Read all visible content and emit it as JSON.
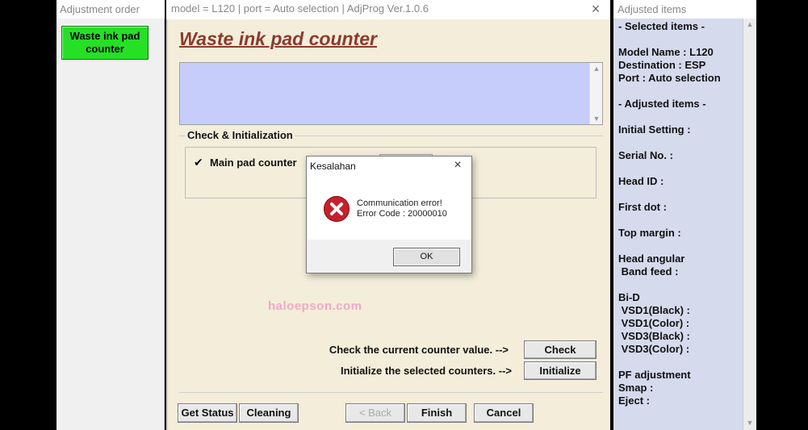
{
  "left_pane": {
    "title": "Adjustment order",
    "items": [
      {
        "label_line1": "Waste ink pad",
        "label_line2": "counter",
        "selected": true,
        "color": "#25e025"
      }
    ]
  },
  "main_window": {
    "titlebar": "model = L120 | port = Auto selection | AdjProg Ver.1.0.6",
    "close_icon": "×",
    "page_title": "Waste ink pad counter",
    "group_label": "Check & Initialization",
    "main_pad_counter": {
      "label": "Main pad counter",
      "checked": true,
      "check_glyph": "✔"
    },
    "watermark": "haloepson.com",
    "check_label": "Check the current counter value. -->",
    "check_button": "Check",
    "init_label": "Initialize the selected counters. -->",
    "init_button": "Initialize",
    "bottom_buttons": {
      "get_status": "Get Status",
      "cleaning": "Cleaning",
      "back": "< Back",
      "finish": "Finish",
      "cancel": "Cancel"
    },
    "accent_colors": {
      "title": "#8b3a2e",
      "info_box": "#c6cdfb",
      "background": "#f3edda"
    }
  },
  "error_dialog": {
    "title": "Kesalahan",
    "close_icon": "×",
    "icon": "error-x-icon",
    "message_line1": "Communication error!",
    "message_line2": "Error Code : 20000010",
    "ok_button": "OK"
  },
  "right_pane": {
    "title": "Adjusted items",
    "lines": [
      {
        "text": "- Selected items -"
      },
      {
        "text": "Model Name : L120"
      },
      {
        "text": "Destination : ESP"
      },
      {
        "text": "Port : Auto selection"
      },
      {
        "text": "- Adjusted items -"
      },
      {
        "text": "Initial Setting :"
      },
      {
        "text": "Serial No. :"
      },
      {
        "text": "Head ID :"
      },
      {
        "text": "First dot :"
      },
      {
        "text": "Top margin :"
      },
      {
        "text": "Head angular"
      },
      {
        "text": " Band feed :"
      },
      {
        "text": "Bi-D"
      },
      {
        "text": " VSD1(Black) :"
      },
      {
        "text": " VSD1(Color) :"
      },
      {
        "text": " VSD3(Black) :"
      },
      {
        "text": " VSD3(Color) :"
      },
      {
        "text": "PF adjustment"
      },
      {
        "text": "Smap :"
      },
      {
        "text": "Eject :"
      }
    ],
    "scroll_up_icon": "▲",
    "scroll_down_icon": "▼"
  }
}
